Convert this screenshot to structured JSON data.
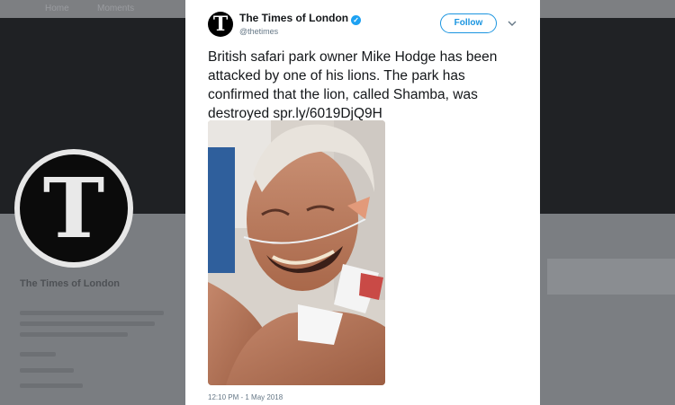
{
  "background": {
    "topbar_items": [
      "Home",
      "Moments"
    ],
    "logo_letter": "T",
    "profile_name": "The Times of London"
  },
  "tweet": {
    "account_name": "The Times of London",
    "handle": "@thetimes",
    "avatar_letter": "T",
    "follow_label": "Follow",
    "text": "British safari park owner Mike Hodge has been attacked by one of his lions. The park has confirmed that the lion, called Shamba, was destroyed ",
    "link": "spr.ly/6019DjQ9H",
    "timestamp": "12:10 PM - 1 May 2018",
    "verified": true
  },
  "colors": {
    "accent": "#1da1f2",
    "follow_border": "#1b95e0",
    "text": "#14171a",
    "muted": "#657786"
  }
}
